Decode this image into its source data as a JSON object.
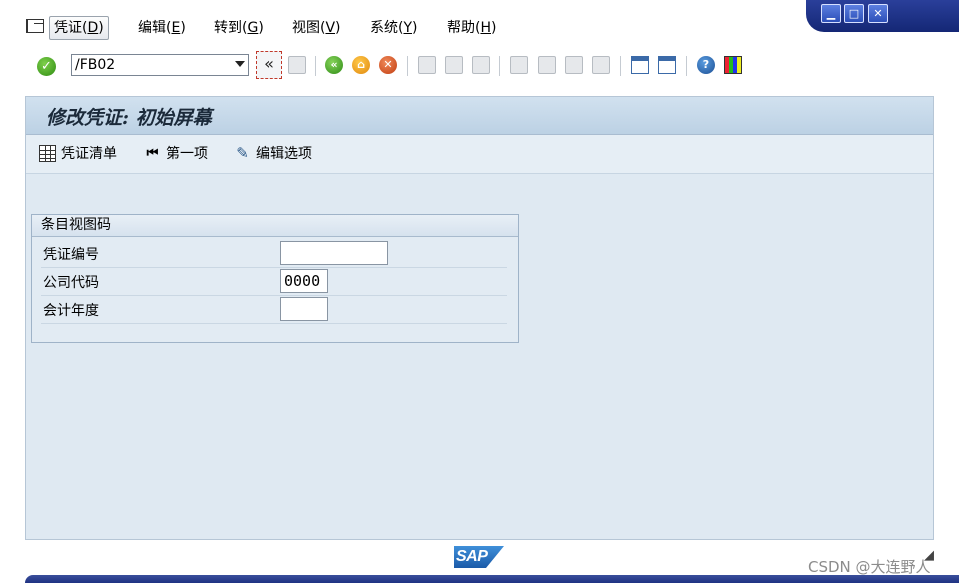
{
  "window": {
    "controls": [
      "minimize",
      "maximize",
      "close"
    ]
  },
  "menubar": {
    "items": [
      {
        "label": "凭证(",
        "key": "D",
        "tail": ")"
      },
      {
        "label": "编辑(",
        "key": "E",
        "tail": ")"
      },
      {
        "label": "转到(",
        "key": "G",
        "tail": ")"
      },
      {
        "label": "视图(",
        "key": "V",
        "tail": ")"
      },
      {
        "label": "系统(",
        "key": "Y",
        "tail": ")"
      },
      {
        "label": "帮助(",
        "key": "H",
        "tail": ")"
      }
    ]
  },
  "toolbar": {
    "command_value": "/FB02",
    "back_label": "«"
  },
  "screen": {
    "title": "修改凭证: 初始屏幕"
  },
  "app_toolbar": {
    "doc_list": "凭证清单",
    "first_item": "第一项",
    "edit_options": "编辑选项"
  },
  "group": {
    "title": "条目视图码",
    "fields": [
      {
        "label": "凭证编号",
        "value": ""
      },
      {
        "label": "公司代码",
        "value": "0000"
      },
      {
        "label": "会计年度",
        "value": ""
      }
    ]
  },
  "footer": {
    "logo": "SAP",
    "watermark": "CSDN @大连野人"
  },
  "colors": {
    "accent": "#1f3282",
    "panel": "#dfe9f2",
    "title_bar": "#c6d8ea"
  }
}
